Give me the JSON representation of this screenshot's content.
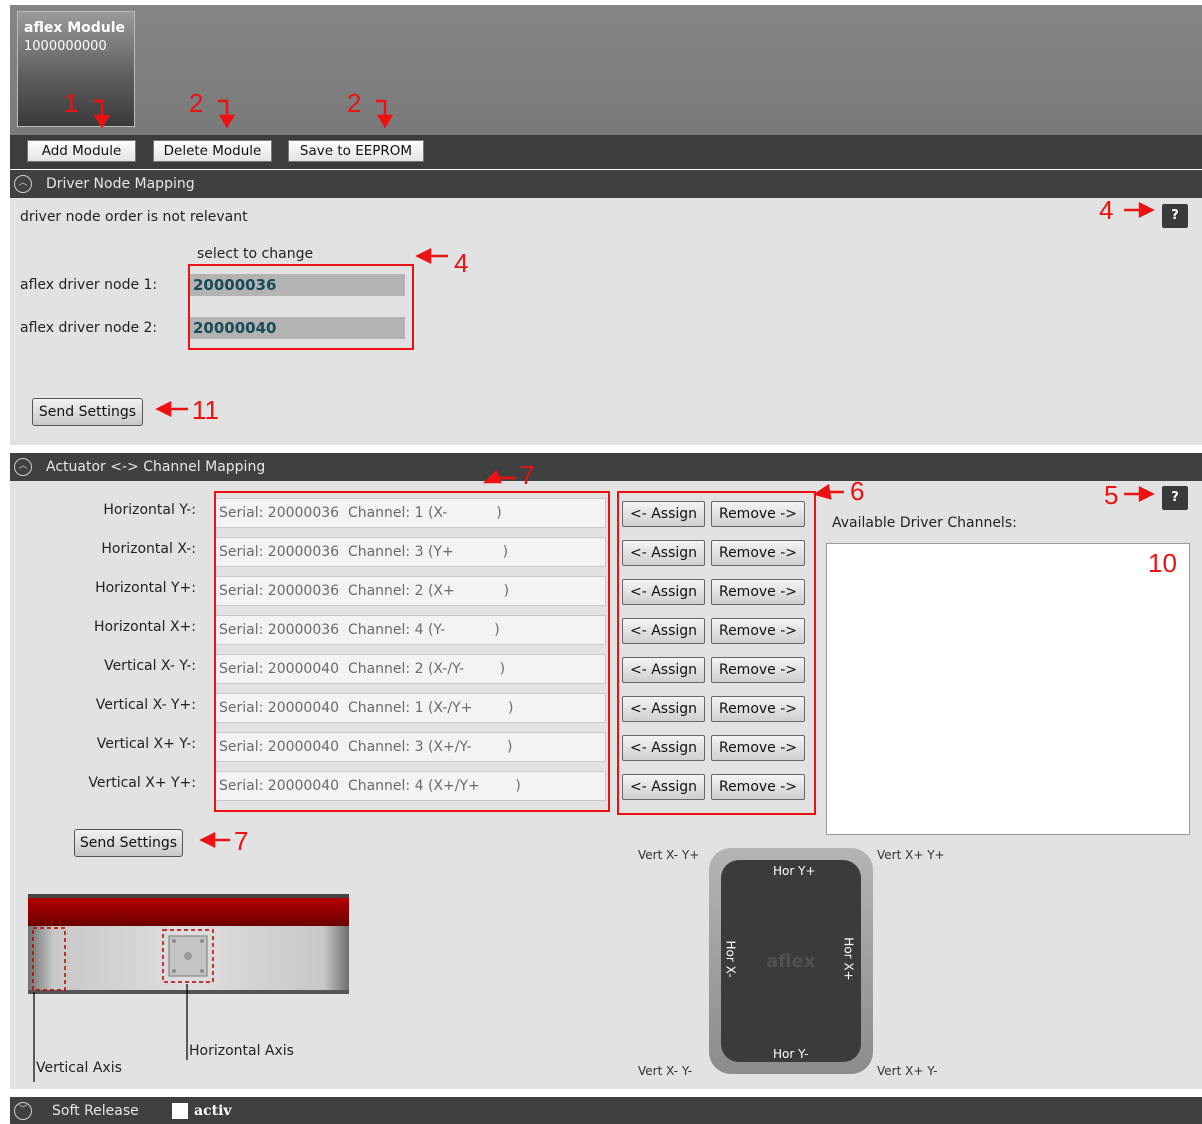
{
  "module": {
    "name": "aflex Module",
    "serial": "1000000000"
  },
  "toolbar": {
    "add": "Add Module",
    "delete": "Delete Module",
    "save": "Save to EEPROM"
  },
  "driver_section": {
    "title": "Driver Node Mapping",
    "note": "driver node order is not relevant",
    "select_hint": "select to change",
    "nodes": [
      {
        "label": "aflex driver node 1:",
        "value": "20000036"
      },
      {
        "label": "aflex driver node 2:",
        "value": "20000040"
      }
    ],
    "send": "Send Settings",
    "help": "?"
  },
  "actuator_section": {
    "title": "Actuator <-> Channel Mapping",
    "rows": [
      {
        "label": "Horizontal Y-:",
        "value": "Serial: 20000036  Channel: 1 (X-           )"
      },
      {
        "label": "Horizontal X-:",
        "value": "Serial: 20000036  Channel: 3 (Y+           )"
      },
      {
        "label": "Horizontal Y+:",
        "value": "Serial: 20000036  Channel: 2 (X+           )"
      },
      {
        "label": "Horizontal X+:",
        "value": "Serial: 20000036  Channel: 4 (Y-           )"
      },
      {
        "label": "Vertical X- Y-:",
        "value": "Serial: 20000040  Channel: 2 (X-/Y-        )"
      },
      {
        "label": "Vertical X- Y+:",
        "value": "Serial: 20000040  Channel: 1 (X-/Y+        )"
      },
      {
        "label": "Vertical X+ Y-:",
        "value": "Serial: 20000040  Channel: 3 (X+/Y-        )"
      },
      {
        "label": "Vertical X+ Y+:",
        "value": "Serial: 20000040  Channel: 4 (X+/Y+        )"
      }
    ],
    "assign": "<- Assign",
    "remove": "Remove ->",
    "available_label": "Available Driver Channels:",
    "send": "Send Settings",
    "help": "?",
    "axis_vertical": "Vertical Axis",
    "axis_horizontal": "Horizontal Axis",
    "pad": {
      "brand": "aflex",
      "hor_y_plus": "Hor Y+",
      "hor_y_minus": "Hor Y-",
      "hor_x_minus": "Hor X-",
      "hor_x_plus": "Hor X+",
      "vert_tl": "Vert X- Y+",
      "vert_tr": "Vert X+ Y+",
      "vert_bl": "Vert X- Y-",
      "vert_br": "Vert X+ Y-"
    }
  },
  "soft_release": {
    "title": "Soft Release",
    "checkbox_label": "activ"
  },
  "annotations": {
    "a1": "1",
    "a2a": "2",
    "a2b": "2",
    "a4help": "4",
    "a4box": "4",
    "a11": "11",
    "a7top": "7",
    "a6": "6",
    "a5": "5",
    "a10": "10",
    "a7send": "7"
  },
  "colors": {
    "annotation": "#ee1111",
    "node_value": "#174b57",
    "header_bg": "#404040"
  }
}
